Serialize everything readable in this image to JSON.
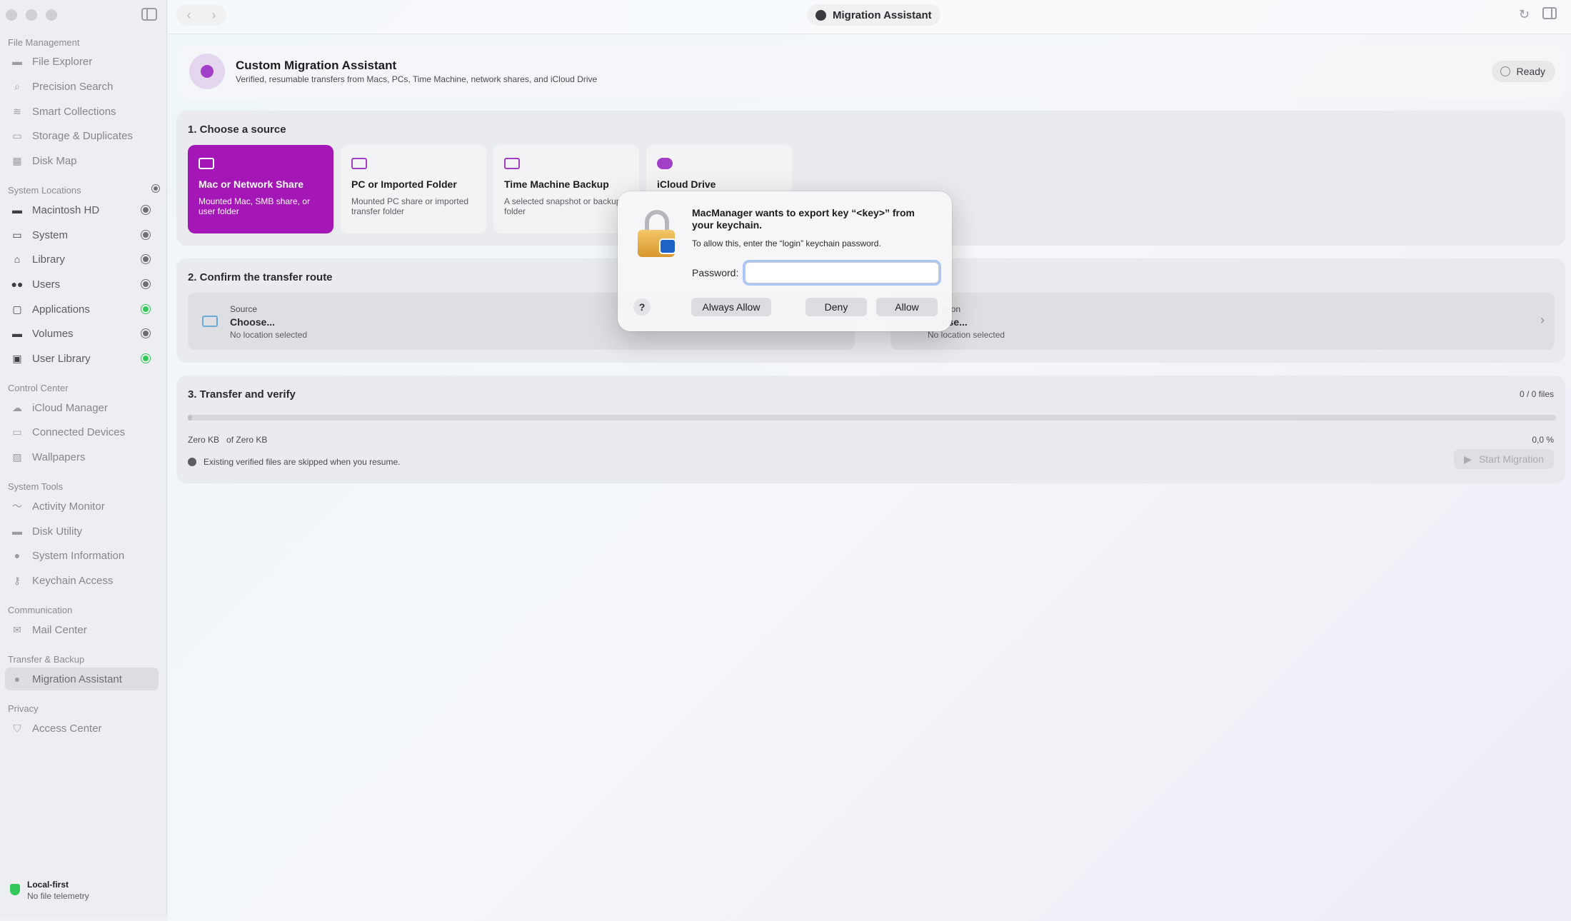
{
  "window": {
    "title": "Migration Assistant"
  },
  "sidebar": {
    "sections": {
      "file_management": "File Management",
      "system_locations": "System Locations",
      "control_center": "Control Center",
      "system_tools": "System Tools",
      "communication": "Communication",
      "transfer_backup": "Transfer & Backup",
      "privacy": "Privacy"
    },
    "file_management": [
      "File Explorer",
      "Precision Search",
      "Smart Collections",
      "Storage & Duplicates",
      "Disk Map"
    ],
    "system_locations": [
      "Macintosh HD",
      "System",
      "Library",
      "Users",
      "Applications",
      "Volumes",
      "User Library"
    ],
    "control_center": [
      "iCloud Manager",
      "Connected Devices",
      "Wallpapers"
    ],
    "system_tools": [
      "Activity Monitor",
      "Disk Utility",
      "System Information",
      "Keychain Access"
    ],
    "communication": [
      "Mail Center"
    ],
    "transfer_backup": [
      "Migration Assistant"
    ],
    "privacy": [
      "Access Center"
    ],
    "footer": {
      "title": "Local-first",
      "subtitle": "No file telemetry"
    }
  },
  "header": {
    "title": "Custom Migration Assistant",
    "subtitle": "Verified, resumable transfers from Macs, PCs, Time Machine, network shares, and iCloud Drive",
    "status": "Ready"
  },
  "step1": {
    "title": "1. Choose a source",
    "tiles": [
      {
        "name": "Mac or Network Share",
        "desc": "Mounted Mac, SMB share, or user folder"
      },
      {
        "name": "PC or Imported Folder",
        "desc": "Mounted PC share or imported transfer folder"
      },
      {
        "name": "Time Machine Backup",
        "desc": "A selected snapshot or backup folder"
      },
      {
        "name": "iCloud Drive",
        "desc": ""
      }
    ]
  },
  "step2": {
    "title": "2. Confirm the transfer route",
    "source": {
      "label": "Source",
      "value": "Choose...",
      "sub": "No location selected"
    },
    "destination": {
      "label": "ation",
      "value": "ose...",
      "sub": "No location selected"
    }
  },
  "step3": {
    "title": "3. Transfer and verify",
    "files": "0 / 0 files",
    "size_done": "Zero KB",
    "size_total": "of Zero KB",
    "percent": "0,0 %",
    "progress": 0,
    "info": "Existing verified files are skipped when you resume.",
    "start": "Start Migration"
  },
  "dialog": {
    "title": "MacManager wants to export key “<key>” from your keychain.",
    "text": "To allow this, enter the “login” keychain password.",
    "password_label": "Password:",
    "password_value": "",
    "help": "?",
    "always_allow": "Always Allow",
    "deny": "Deny",
    "allow": "Allow"
  },
  "colors": {
    "accent": "#a417b6",
    "green": "#34c759"
  }
}
